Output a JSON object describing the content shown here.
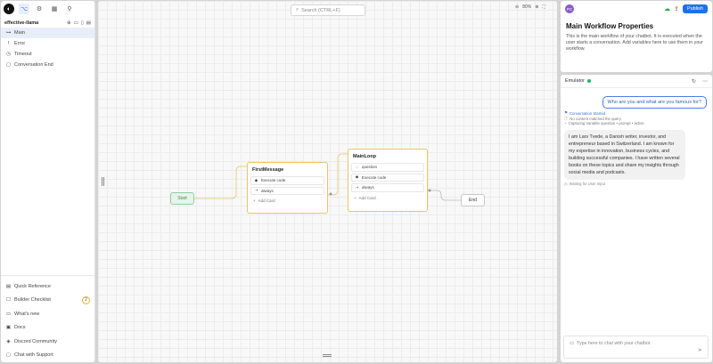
{
  "sidebar": {
    "top_icons": [
      "logo-icon",
      "flows-icon",
      "integrations-icon",
      "library-icon",
      "hooks-icon"
    ],
    "bot_name": "effective-llama",
    "nav": [
      {
        "label": "Main",
        "icon": "main-flow-icon",
        "glyph": "⊶",
        "active": true
      },
      {
        "label": "Error",
        "icon": "error-flow-icon",
        "glyph": "!",
        "active": false
      },
      {
        "label": "Timeout",
        "icon": "timeout-flow-icon",
        "glyph": "◷",
        "active": false
      },
      {
        "label": "Conversation End",
        "icon": "conversation-end-icon",
        "glyph": "▢",
        "active": false
      }
    ],
    "bottom": [
      {
        "label": "Quick Reference",
        "icon": "quick-reference-icon",
        "glyph": "▤"
      },
      {
        "label": "Builder Checklist",
        "icon": "checklist-icon",
        "glyph": "☐",
        "badge": "2"
      },
      {
        "label": "What's new",
        "icon": "whats-new-icon",
        "glyph": "▭"
      },
      {
        "label": "Docs",
        "icon": "docs-icon",
        "glyph": "▣"
      },
      {
        "label": "Discord Community",
        "icon": "discord-icon",
        "glyph": "◈"
      },
      {
        "label": "Chat with Support",
        "icon": "support-chat-icon",
        "glyph": "▢"
      }
    ]
  },
  "canvas": {
    "search_placeholder": "Search (CTRL+F)",
    "zoom": "80%",
    "nodes": {
      "start": "Start",
      "end": "End",
      "first": {
        "title": "FirstMessage",
        "cards": [
          {
            "label": "Execute code",
            "icon": "execute-code-icon",
            "glyph": "◆"
          },
          {
            "label": "always",
            "icon": "always-transition-icon",
            "glyph": "⇢"
          }
        ],
        "add": "Add Card"
      },
      "main": {
        "title": "MainLoop",
        "cards": [
          {
            "label": "question",
            "icon": "question-icon",
            "glyph": "◌"
          },
          {
            "label": "Execute code",
            "icon": "execute-code-icon",
            "glyph": "◆"
          },
          {
            "label": "always",
            "icon": "always-transition-icon",
            "glyph": "⇢"
          }
        ],
        "add": "Add Card"
      }
    }
  },
  "right": {
    "avatar": "PC",
    "publish": "Publish",
    "title": "Main Workflow Properties",
    "description": "This is the main workflow of your chatbot. It is executed when the user starts a conversation. Add variables here to use them in your workflow.",
    "emulator": {
      "label": "Emulator",
      "user_message": "Who are you and what are you famous for?",
      "trace_started": "Conversation Started",
      "trace_no_content": "No content matched the query",
      "trace_capturing": "Capturing Variable question • prompt • active",
      "bot_message": "I am Lars Tvede, a Danish writer, investor, and entrepreneur based in Switzerland. I am known for my expertise in innovation, business cycles, and building successful companies. I have written several books on these topics and share my insights through social media and podcasts.",
      "waiting": "Waiting for User Input",
      "input_placeholder": "Type here to chat with your chatbot"
    }
  },
  "colors": {
    "accent": "#1f6feb",
    "flow_node_border": "#e9c46a",
    "start_node": "#8fcf9f",
    "status_online": "#2ab36b"
  }
}
